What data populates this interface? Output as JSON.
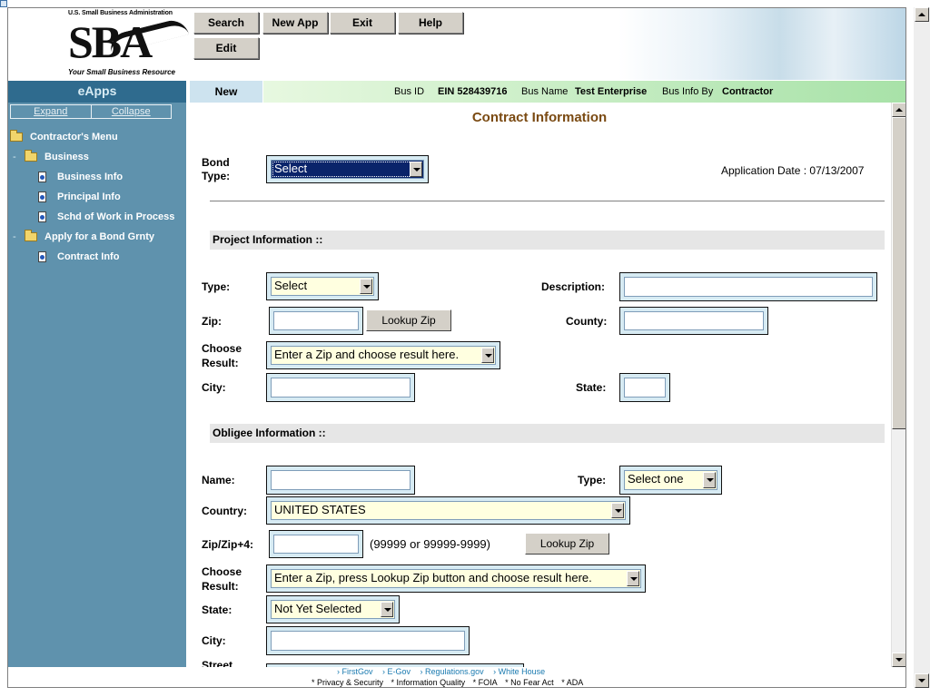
{
  "header": {
    "agency": "U.S. Small Business Administration",
    "logo": "SBA",
    "tagline": "Your Small Business Resource",
    "buttons": [
      "Search",
      "New App",
      "Exit",
      "Help",
      "Edit"
    ]
  },
  "sidebar": {
    "title": "eApps",
    "expand": "Expand",
    "collapse": "Collapse",
    "tree": [
      {
        "label": "Contractor's Menu",
        "icon": "folder-icon"
      },
      {
        "label": "Business",
        "icon": "folder-icon"
      },
      {
        "label": "Business Info",
        "icon": "page-icon"
      },
      {
        "label": "Principal Info",
        "icon": "page-icon"
      },
      {
        "label": "Schd of Work in Process",
        "icon": "page-icon"
      },
      {
        "label": "Apply for a Bond Grnty",
        "icon": "folder-icon"
      },
      {
        "label": "Contract Info",
        "icon": "page-icon"
      }
    ],
    "dashes": [
      "-",
      "-"
    ]
  },
  "status_bar": {
    "new_tab": "New",
    "bus_id_label": "Bus ID",
    "ein": "EIN  528439716",
    "bus_name_label": "Bus Name",
    "bus_name": "Test Enterprise",
    "bus_info_by_label": "Bus Info By",
    "bus_info_by": "Contractor"
  },
  "form": {
    "title": "Contract Information",
    "bond_type_label": "Bond Type:",
    "bond_type_value": "Select",
    "application_date": "Application Date : 07/13/2007",
    "project_section": "Project Information ::",
    "type_label": "Type:",
    "type_value": "Select",
    "description_label": "Description:",
    "zip_label": "Zip:",
    "lookup_zip": "Lookup Zip",
    "county_label": "County:",
    "choose_result_label": "Choose Result:",
    "choose_result_value": "Enter a Zip and choose result here.",
    "city_label": "City:",
    "state_label": "State:",
    "obligee_section": "Obligee Information ::",
    "name_label": "Name:",
    "obligee_type_label": "Type:",
    "obligee_type_value": "Select one",
    "country_label": "Country:",
    "country_value": "UNITED STATES",
    "zip4_label": "Zip/Zip+4:",
    "zip_format_hint": "(99999 or 99999-9999)",
    "lookup_zip2": "Lookup Zip",
    "choose_result2_label": "Choose Result:",
    "choose_result2_value": "Enter a Zip, press Lookup Zip button and choose result here.",
    "obligee_state_label": "State:",
    "obligee_state_value": "Not Yet Selected",
    "obligee_city_label": "City:",
    "street_label": "Street"
  },
  "footer": {
    "links1": [
      "› FirstGov",
      "› E-Gov",
      "› Regulations.gov",
      "› White House"
    ],
    "links2": [
      "* Privacy & Security",
      "* Information Quality",
      "* FOIA",
      "* No Fear Act",
      "* ADA"
    ]
  }
}
